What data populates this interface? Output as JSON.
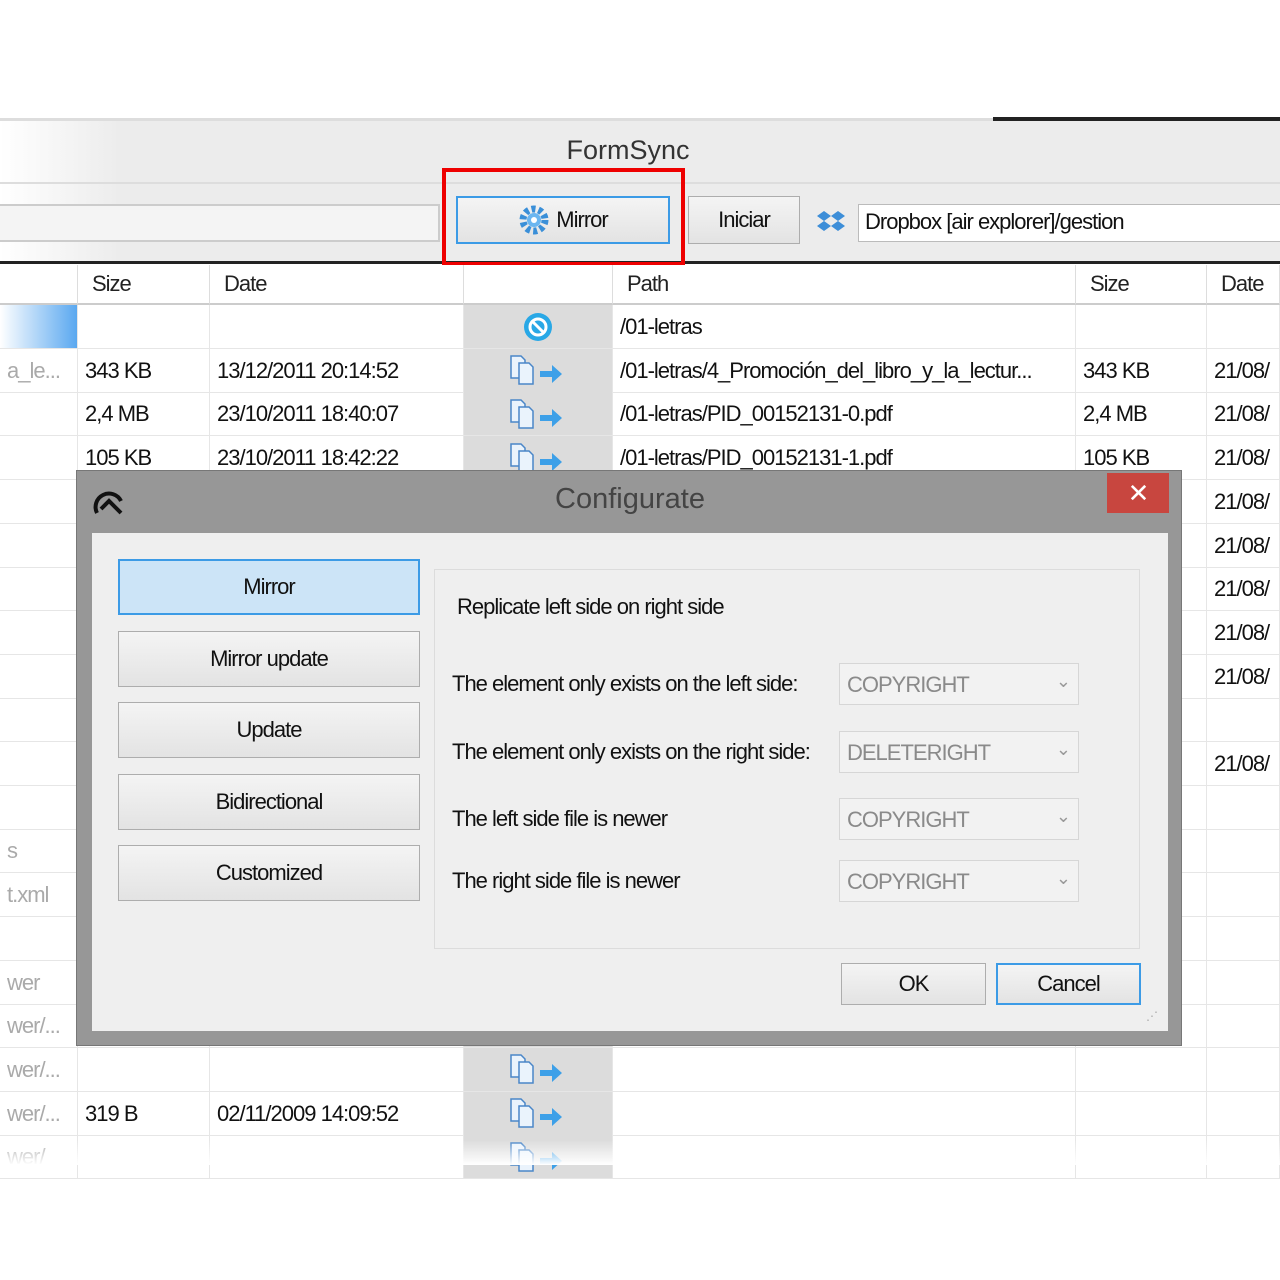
{
  "app": {
    "title": "FormSync"
  },
  "toolbar": {
    "mirror_label": "Mirror",
    "iniciar_label": "Iniciar",
    "remote_path": "Dropbox [air explorer]/gestion"
  },
  "table": {
    "headers": {
      "size_left": "Size",
      "date_left": "Date",
      "action": "",
      "path": "Path",
      "size_right": "Size",
      "date_right": "Date"
    },
    "rows": [
      {
        "name": "",
        "size": "",
        "date": "",
        "action": "skip",
        "path": "/01-letras",
        "rsize": "",
        "rdate": ""
      },
      {
        "name": "a_le...",
        "size": "343 KB",
        "date": "13/12/2011 20:14:52",
        "action": "copy-right",
        "path": "/01-letras/4_Promoción_del_libro_y_la_lectur...",
        "rsize": "343 KB",
        "rdate": "21/08/"
      },
      {
        "name": "",
        "size": "2,4 MB",
        "date": "23/10/2011 18:40:07",
        "action": "copy-right",
        "path": "/01-letras/PID_00152131-0.pdf",
        "rsize": "2,4 MB",
        "rdate": "21/08/"
      },
      {
        "name": "",
        "size": "105 KB",
        "date": "23/10/2011 18:42:22",
        "action": "copy-right",
        "path": "/01-letras/PID_00152131-1.pdf",
        "rsize": "105 KB",
        "rdate": "21/08/"
      },
      {
        "name": "",
        "size": "",
        "date": "",
        "action": "",
        "path": "",
        "rsize": "",
        "rdate": "21/08/"
      },
      {
        "name": "",
        "size": "",
        "date": "",
        "action": "",
        "path": "",
        "rsize": "",
        "rdate": "21/08/"
      },
      {
        "name": "",
        "size": "",
        "date": "",
        "action": "",
        "path": "",
        "rsize": "",
        "rdate": "21/08/"
      },
      {
        "name": "",
        "size": "",
        "date": "",
        "action": "",
        "path": "",
        "rsize": "",
        "rdate": "21/08/"
      },
      {
        "name": "",
        "size": "",
        "date": "",
        "action": "",
        "path": "",
        "rsize": "",
        "rdate": "21/08/"
      },
      {
        "name": "",
        "size": "",
        "date": "",
        "action": "",
        "path": "",
        "rsize": "",
        "rdate": ""
      },
      {
        "name": "",
        "size": "",
        "date": "",
        "action": "",
        "path": "",
        "rsize": "",
        "rdate": "21/08/"
      },
      {
        "name": "",
        "size": "",
        "date": "",
        "action": "",
        "path": "",
        "rsize": "",
        "rdate": ""
      },
      {
        "name": "s",
        "size": "",
        "date": "",
        "action": "",
        "path": "",
        "rsize": "",
        "rdate": ""
      },
      {
        "name": "t.xml",
        "size": "",
        "date": "",
        "action": "",
        "path": "",
        "rsize": "",
        "rdate": ""
      },
      {
        "name": "",
        "size": "",
        "date": "",
        "action": "",
        "path": "",
        "rsize": "",
        "rdate": ""
      },
      {
        "name": "wer",
        "size": "",
        "date": "",
        "action": "",
        "path": "",
        "rsize": "",
        "rdate": ""
      },
      {
        "name": "wer/...",
        "size": "",
        "date": "",
        "action": "",
        "path": "",
        "rsize": "",
        "rdate": ""
      },
      {
        "name": "wer/...",
        "size": "",
        "date": "",
        "action": "copy-right",
        "path": "",
        "rsize": "",
        "rdate": ""
      },
      {
        "name": "wer/...",
        "size": "319 B",
        "date": "02/11/2009 14:09:52",
        "action": "copy-right",
        "path": "",
        "rsize": "",
        "rdate": ""
      },
      {
        "name": "wer/",
        "size": "",
        "date": "",
        "action": "copy-right",
        "path": "",
        "rsize": "",
        "rdate": ""
      }
    ]
  },
  "dialog": {
    "title": "Configurate",
    "close_label": "✕",
    "modes": [
      "Mirror",
      "Mirror update",
      "Update",
      "Bidirectional",
      "Customized"
    ],
    "selected_mode": "Mirror",
    "description": "Replicate left side on right side",
    "rules": [
      {
        "label": "The element only exists on the left side:",
        "value": "COPYRIGHT"
      },
      {
        "label": "The element only exists on the right side:",
        "value": "DELETERIGHT"
      },
      {
        "label": "The left side file is newer",
        "value": "COPYRIGHT"
      },
      {
        "label": "The right side file is newer",
        "value": "COPYRIGHT"
      }
    ],
    "ok_label": "OK",
    "cancel_label": "Cancel"
  },
  "colors": {
    "highlight": "#e00000",
    "accent": "#3c9be6",
    "close": "#c8463f"
  }
}
